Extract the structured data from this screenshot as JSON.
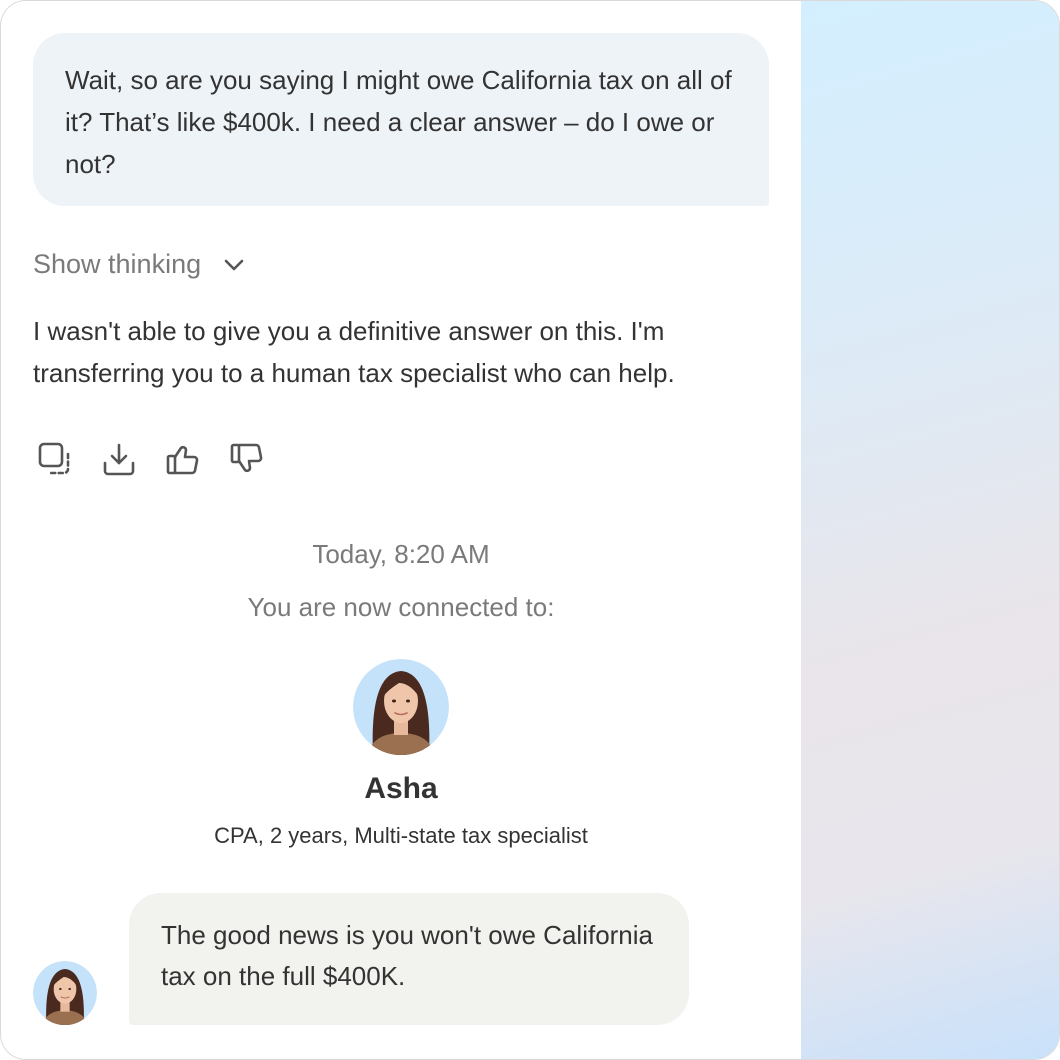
{
  "conversation": {
    "user_message": "Wait, so are you saying I might owe California tax on all of it? That’s like $400k. I need a clear answer – do I owe or not?",
    "show_thinking_label": "Show thinking",
    "assistant_message": "I wasn't able to give you a definitive answer on this. I'm transferring you to a human tax specialist who can help.",
    "message_actions": [
      "copy-icon",
      "download-icon",
      "thumbs-up-icon",
      "thumbs-down-icon"
    ],
    "timestamp": "Today, 8:20 AM",
    "connected_label": "You are now connected to:",
    "agent": {
      "name": "Asha",
      "credentials": "CPA, 2 years, Multi-state tax specialist"
    },
    "agent_message": "The good news is you won't owe California tax on the full $400K."
  },
  "colors": {
    "user_bubble": "#eef3f8",
    "agent_bubble": "#f2f2ee",
    "muted_text": "#7a7a7a",
    "body_text": "#333333",
    "avatar_bg": "#c5e2fb"
  }
}
